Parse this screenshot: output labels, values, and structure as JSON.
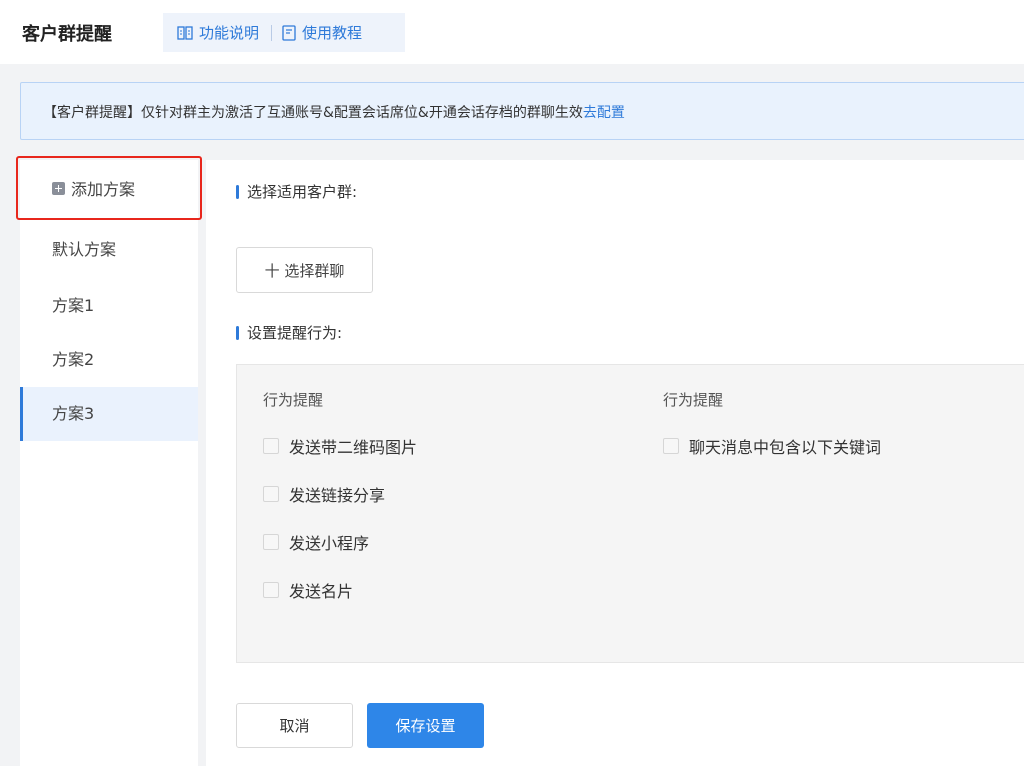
{
  "header": {
    "title": "客户群提醒",
    "links": [
      {
        "icon": "book-icon",
        "label": "功能说明"
      },
      {
        "icon": "document-icon",
        "label": "使用教程"
      }
    ]
  },
  "notice": {
    "text": "【客户群提醒】仅针对群主为激活了互通账号&配置会话席位&开通会话存档的群聊生效",
    "link": "去配置"
  },
  "sidebar": {
    "add_label": "添加方案",
    "items": [
      {
        "label": "默认方案",
        "active": false
      },
      {
        "label": "方案1",
        "active": false
      },
      {
        "label": "方案2",
        "active": false
      },
      {
        "label": "方案3",
        "active": true
      }
    ]
  },
  "main": {
    "select_group_title": "选择适用客户群:",
    "select_group_button": "十 选择群聊",
    "behavior_title": "设置提醒行为:",
    "columns": [
      {
        "title": "行为提醒",
        "options": [
          "发送带二维码图片",
          "发送链接分享",
          "发送小程序",
          "发送名片"
        ]
      },
      {
        "title": "行为提醒",
        "options": [
          "聊天消息中包含以下关键词"
        ]
      }
    ],
    "cancel_label": "取消",
    "save_label": "保存设置"
  },
  "colors": {
    "accent": "#2e7ad9",
    "primary_button": "#2e86e8",
    "highlight_border": "#e8261c"
  }
}
